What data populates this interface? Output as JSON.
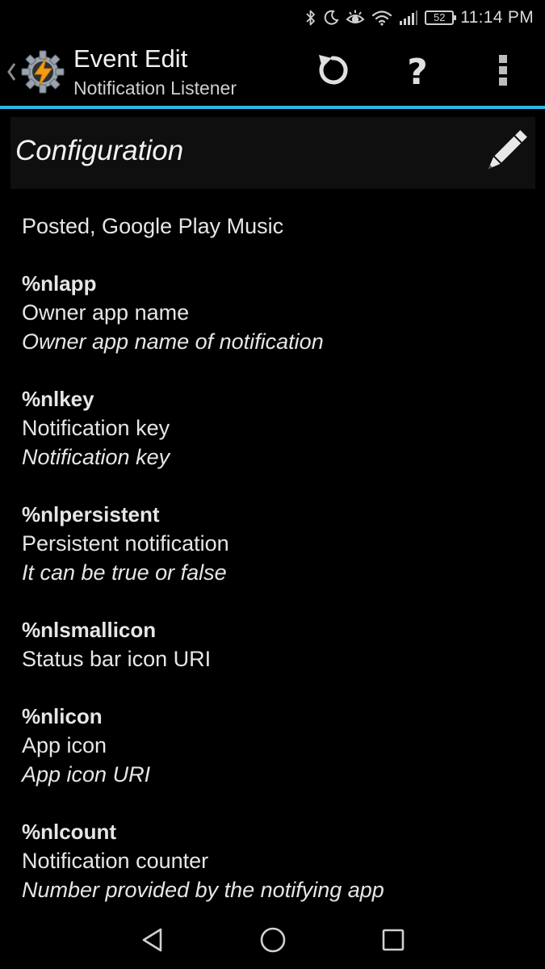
{
  "status_bar": {
    "battery_level": "52",
    "time": "11:14 PM",
    "icons": [
      "bluetooth-icon",
      "do-not-disturb-moon-icon",
      "eye-comfort-icon",
      "wifi-icon",
      "signal-icon",
      "battery-icon"
    ]
  },
  "action_bar": {
    "title": "Event Edit",
    "subtitle": "Notification Listener",
    "icons": [
      "up-caret-icon",
      "tasker-logo-icon",
      "revert-icon",
      "help-icon",
      "overflow-menu-icon"
    ],
    "help_glyph": "?"
  },
  "config": {
    "title": "Configuration",
    "edit_icon": "pencil-icon"
  },
  "summary": "Posted, Google Play Music",
  "variables": [
    {
      "name": "%nlapp",
      "label": "Owner app name",
      "description": "Owner app name of notification"
    },
    {
      "name": "%nlkey",
      "label": "Notification key",
      "description": "Notification key"
    },
    {
      "name": "%nlpersistent",
      "label": "Persistent notification",
      "description": "It can be true or false"
    },
    {
      "name": "%nlsmallicon",
      "label": "Status bar icon URI",
      "description": ""
    },
    {
      "name": "%nlicon",
      "label": "App icon",
      "description": "App icon URI"
    },
    {
      "name": "%nlcount",
      "label": "Notification counter",
      "description": "Number provided by the notifying app"
    }
  ],
  "nav_bar": {
    "icons": [
      "back-icon",
      "home-icon",
      "recents-icon"
    ]
  },
  "colors": {
    "accent": "#33b5e5",
    "logo_orange": "#f39c12"
  }
}
